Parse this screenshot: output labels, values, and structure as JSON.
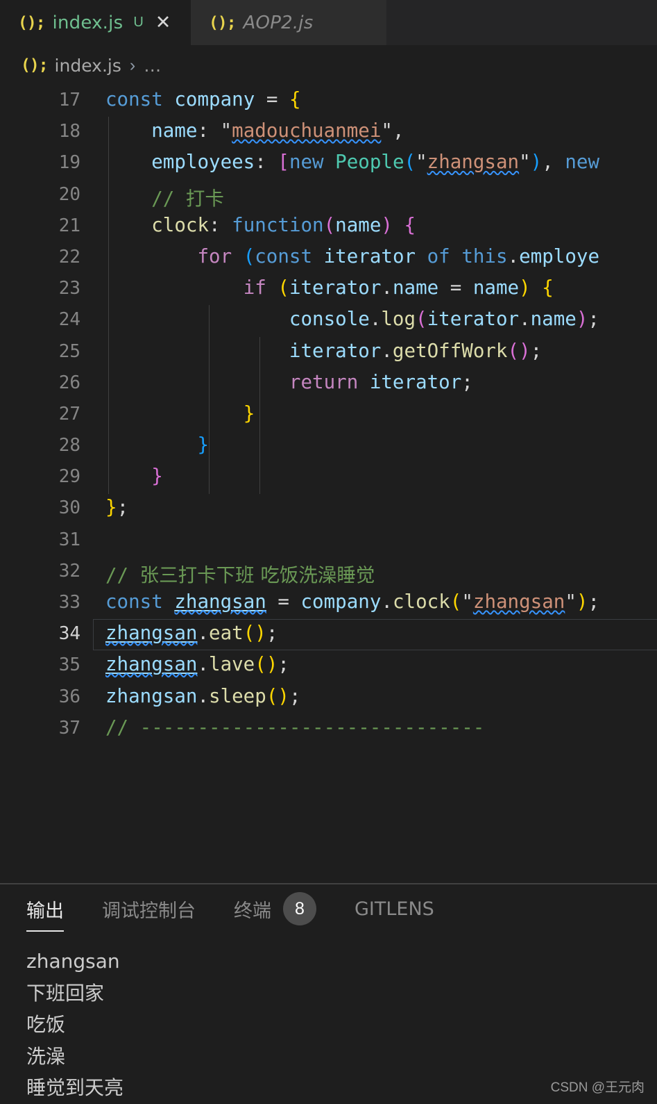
{
  "window": {
    "theme_bg": "#1e1e1e",
    "tabbar_bg": "#252526",
    "accent": "#6fbf8f"
  },
  "tabs": [
    {
      "icon": "js-file-icon",
      "icon_glyph": "();",
      "label": "index.js",
      "dirty_indicator": "U",
      "close_glyph": "✕",
      "active": true
    },
    {
      "icon": "js-file-icon",
      "icon_glyph": "();",
      "label": "AOP2.js",
      "dirty_indicator": "",
      "close_glyph": "",
      "active": false
    }
  ],
  "breadcrumb": {
    "icon_glyph": "();",
    "file": "index.js",
    "separator": "›",
    "overflow": "…"
  },
  "editor": {
    "first_line_number": 17,
    "active_line_number": 34,
    "lines": [
      {
        "n": 17,
        "text": "const company = {"
      },
      {
        "n": 18,
        "text": "    name: \"madouchuanmei\","
      },
      {
        "n": 19,
        "text": "    employees: [new People(\"zhangsan\"), new"
      },
      {
        "n": 20,
        "text": "    // 打卡"
      },
      {
        "n": 21,
        "text": "    clock: function(name) {"
      },
      {
        "n": 22,
        "text": "        for (const iterator of this.employe"
      },
      {
        "n": 23,
        "text": "            if (iterator.name = name) {"
      },
      {
        "n": 24,
        "text": "                console.log(iterator.name);"
      },
      {
        "n": 25,
        "text": "                iterator.getOffWork();"
      },
      {
        "n": 26,
        "text": "                return iterator;"
      },
      {
        "n": 27,
        "text": "            }"
      },
      {
        "n": 28,
        "text": "        }"
      },
      {
        "n": 29,
        "text": "    }"
      },
      {
        "n": 30,
        "text": "};"
      },
      {
        "n": 31,
        "text": ""
      },
      {
        "n": 32,
        "text": "// 张三打卡下班 吃饭洗澡睡觉"
      },
      {
        "n": 33,
        "text": "const zhangsan = company.clock(\"zhangsan\");"
      },
      {
        "n": 34,
        "text": "zhangsan.eat();"
      },
      {
        "n": 35,
        "text": "zhangsan.lave();"
      },
      {
        "n": 36,
        "text": "zhangsan.sleep();"
      },
      {
        "n": 37,
        "text": "// ------------------------------"
      }
    ]
  },
  "panel": {
    "tabs": [
      {
        "label": "输出",
        "badge": "",
        "active": true
      },
      {
        "label": "调试控制台",
        "badge": "",
        "active": false
      },
      {
        "label": "终端",
        "badge": "8",
        "active": false
      },
      {
        "label": "GITLENS",
        "badge": "",
        "active": false
      }
    ],
    "output_lines": [
      "zhangsan",
      "下班回家",
      "吃饭",
      "洗澡",
      "睡觉到天亮"
    ]
  },
  "watermark": "CSDN @王元肉"
}
